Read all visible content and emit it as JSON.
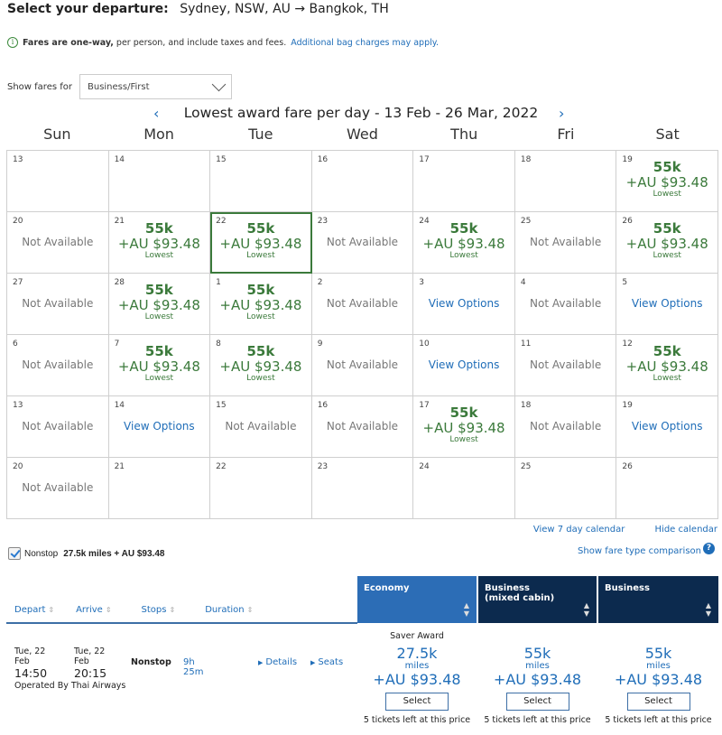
{
  "header": {
    "label": "Select your departure:",
    "route": "Sydney, NSW, AU → Bangkok, TH"
  },
  "notice": {
    "icon": "info-icon",
    "bold": "Fares are one-way,",
    "text": "per person, and include taxes and fees.",
    "link": "Additional bag charges may apply."
  },
  "fare_filter": {
    "label": "Show fares for",
    "selected": "Business/First"
  },
  "calendar": {
    "title": "Lowest award fare per day - 13 Feb - 26 Mar, 2022",
    "prev_icon": "‹",
    "next_icon": "›",
    "weekdays": [
      "Sun",
      "Mon",
      "Tue",
      "Wed",
      "Thu",
      "Fri",
      "Sat"
    ],
    "selected_day_index": 9,
    "fare_text": {
      "miles": "55k",
      "cash": "+AU $93.48",
      "tag": "Lowest"
    },
    "na_text": "Not Available",
    "view_text": "View Options",
    "days": [
      {
        "day": "13",
        "status": "empty"
      },
      {
        "day": "14",
        "status": "empty"
      },
      {
        "day": "15",
        "status": "empty"
      },
      {
        "day": "16",
        "status": "empty"
      },
      {
        "day": "17",
        "status": "empty"
      },
      {
        "day": "18",
        "status": "empty"
      },
      {
        "day": "19",
        "status": "fare"
      },
      {
        "day": "20",
        "status": "na"
      },
      {
        "day": "21",
        "status": "fare"
      },
      {
        "day": "22",
        "status": "fare"
      },
      {
        "day": "23",
        "status": "na"
      },
      {
        "day": "24",
        "status": "fare"
      },
      {
        "day": "25",
        "status": "na"
      },
      {
        "day": "26",
        "status": "fare"
      },
      {
        "day": "27",
        "status": "na"
      },
      {
        "day": "28",
        "status": "fare"
      },
      {
        "day": "1",
        "status": "fare"
      },
      {
        "day": "2",
        "status": "na"
      },
      {
        "day": "3",
        "status": "view"
      },
      {
        "day": "4",
        "status": "na"
      },
      {
        "day": "5",
        "status": "view"
      },
      {
        "day": "6",
        "status": "na"
      },
      {
        "day": "7",
        "status": "fare"
      },
      {
        "day": "8",
        "status": "fare"
      },
      {
        "day": "9",
        "status": "na"
      },
      {
        "day": "10",
        "status": "view"
      },
      {
        "day": "11",
        "status": "na"
      },
      {
        "day": "12",
        "status": "fare"
      },
      {
        "day": "13",
        "status": "na"
      },
      {
        "day": "14",
        "status": "view"
      },
      {
        "day": "15",
        "status": "na"
      },
      {
        "day": "16",
        "status": "na"
      },
      {
        "day": "17",
        "status": "fare"
      },
      {
        "day": "18",
        "status": "na"
      },
      {
        "day": "19",
        "status": "view"
      },
      {
        "day": "20",
        "status": "na"
      },
      {
        "day": "21",
        "status": "empty"
      },
      {
        "day": "22",
        "status": "empty"
      },
      {
        "day": "23",
        "status": "empty"
      },
      {
        "day": "24",
        "status": "empty"
      },
      {
        "day": "25",
        "status": "empty"
      },
      {
        "day": "26",
        "status": "empty"
      }
    ],
    "links": {
      "seven_day": "View 7 day calendar",
      "hide": "Hide calendar"
    }
  },
  "filters": {
    "nonstop_label": "Nonstop",
    "nonstop_checked": true,
    "nonstop_summary": "27.5k miles + AU $93.48",
    "compare_link": "Show fare type comparison",
    "compare_icon": "?"
  },
  "sort_columns": [
    {
      "label": "Depart"
    },
    {
      "label": "Arrive"
    },
    {
      "label": "Stops"
    },
    {
      "label": "Duration"
    }
  ],
  "sort_icon": "↕",
  "cabins": [
    {
      "label": "Economy",
      "sub": ""
    },
    {
      "label": "Business",
      "sub": "(mixed cabin)"
    },
    {
      "label": "Business",
      "sub": ""
    }
  ],
  "flight": {
    "depart_date": "Tue, 22 Feb",
    "depart_time": "14:50",
    "arrive_date": "Tue, 22 Feb",
    "arrive_time": "20:15",
    "stops": "Nonstop",
    "duration": "9h 25m",
    "details_link": "Details",
    "seats_link": "Seats",
    "operator": "Operated By Thai Airways",
    "fares": [
      {
        "type": "Saver Award",
        "miles": "27.5k",
        "miles_label": "miles",
        "cash": "+AU $93.48",
        "button": "Select",
        "availability": "5 tickets left at this price"
      },
      {
        "type": "",
        "miles": "55k",
        "miles_label": "miles",
        "cash": "+AU $93.48",
        "button": "Select",
        "availability": "5 tickets left at this price"
      },
      {
        "type": "",
        "miles": "55k",
        "miles_label": "miles",
        "cash": "+AU $93.48",
        "button": "Select",
        "availability": "5 tickets left at this price"
      }
    ]
  },
  "colors": {
    "fare_green": "#3b7a3b",
    "link_blue": "#1f6db8",
    "economy_header": "#2c6db6",
    "business_header": "#0c2a4e"
  }
}
